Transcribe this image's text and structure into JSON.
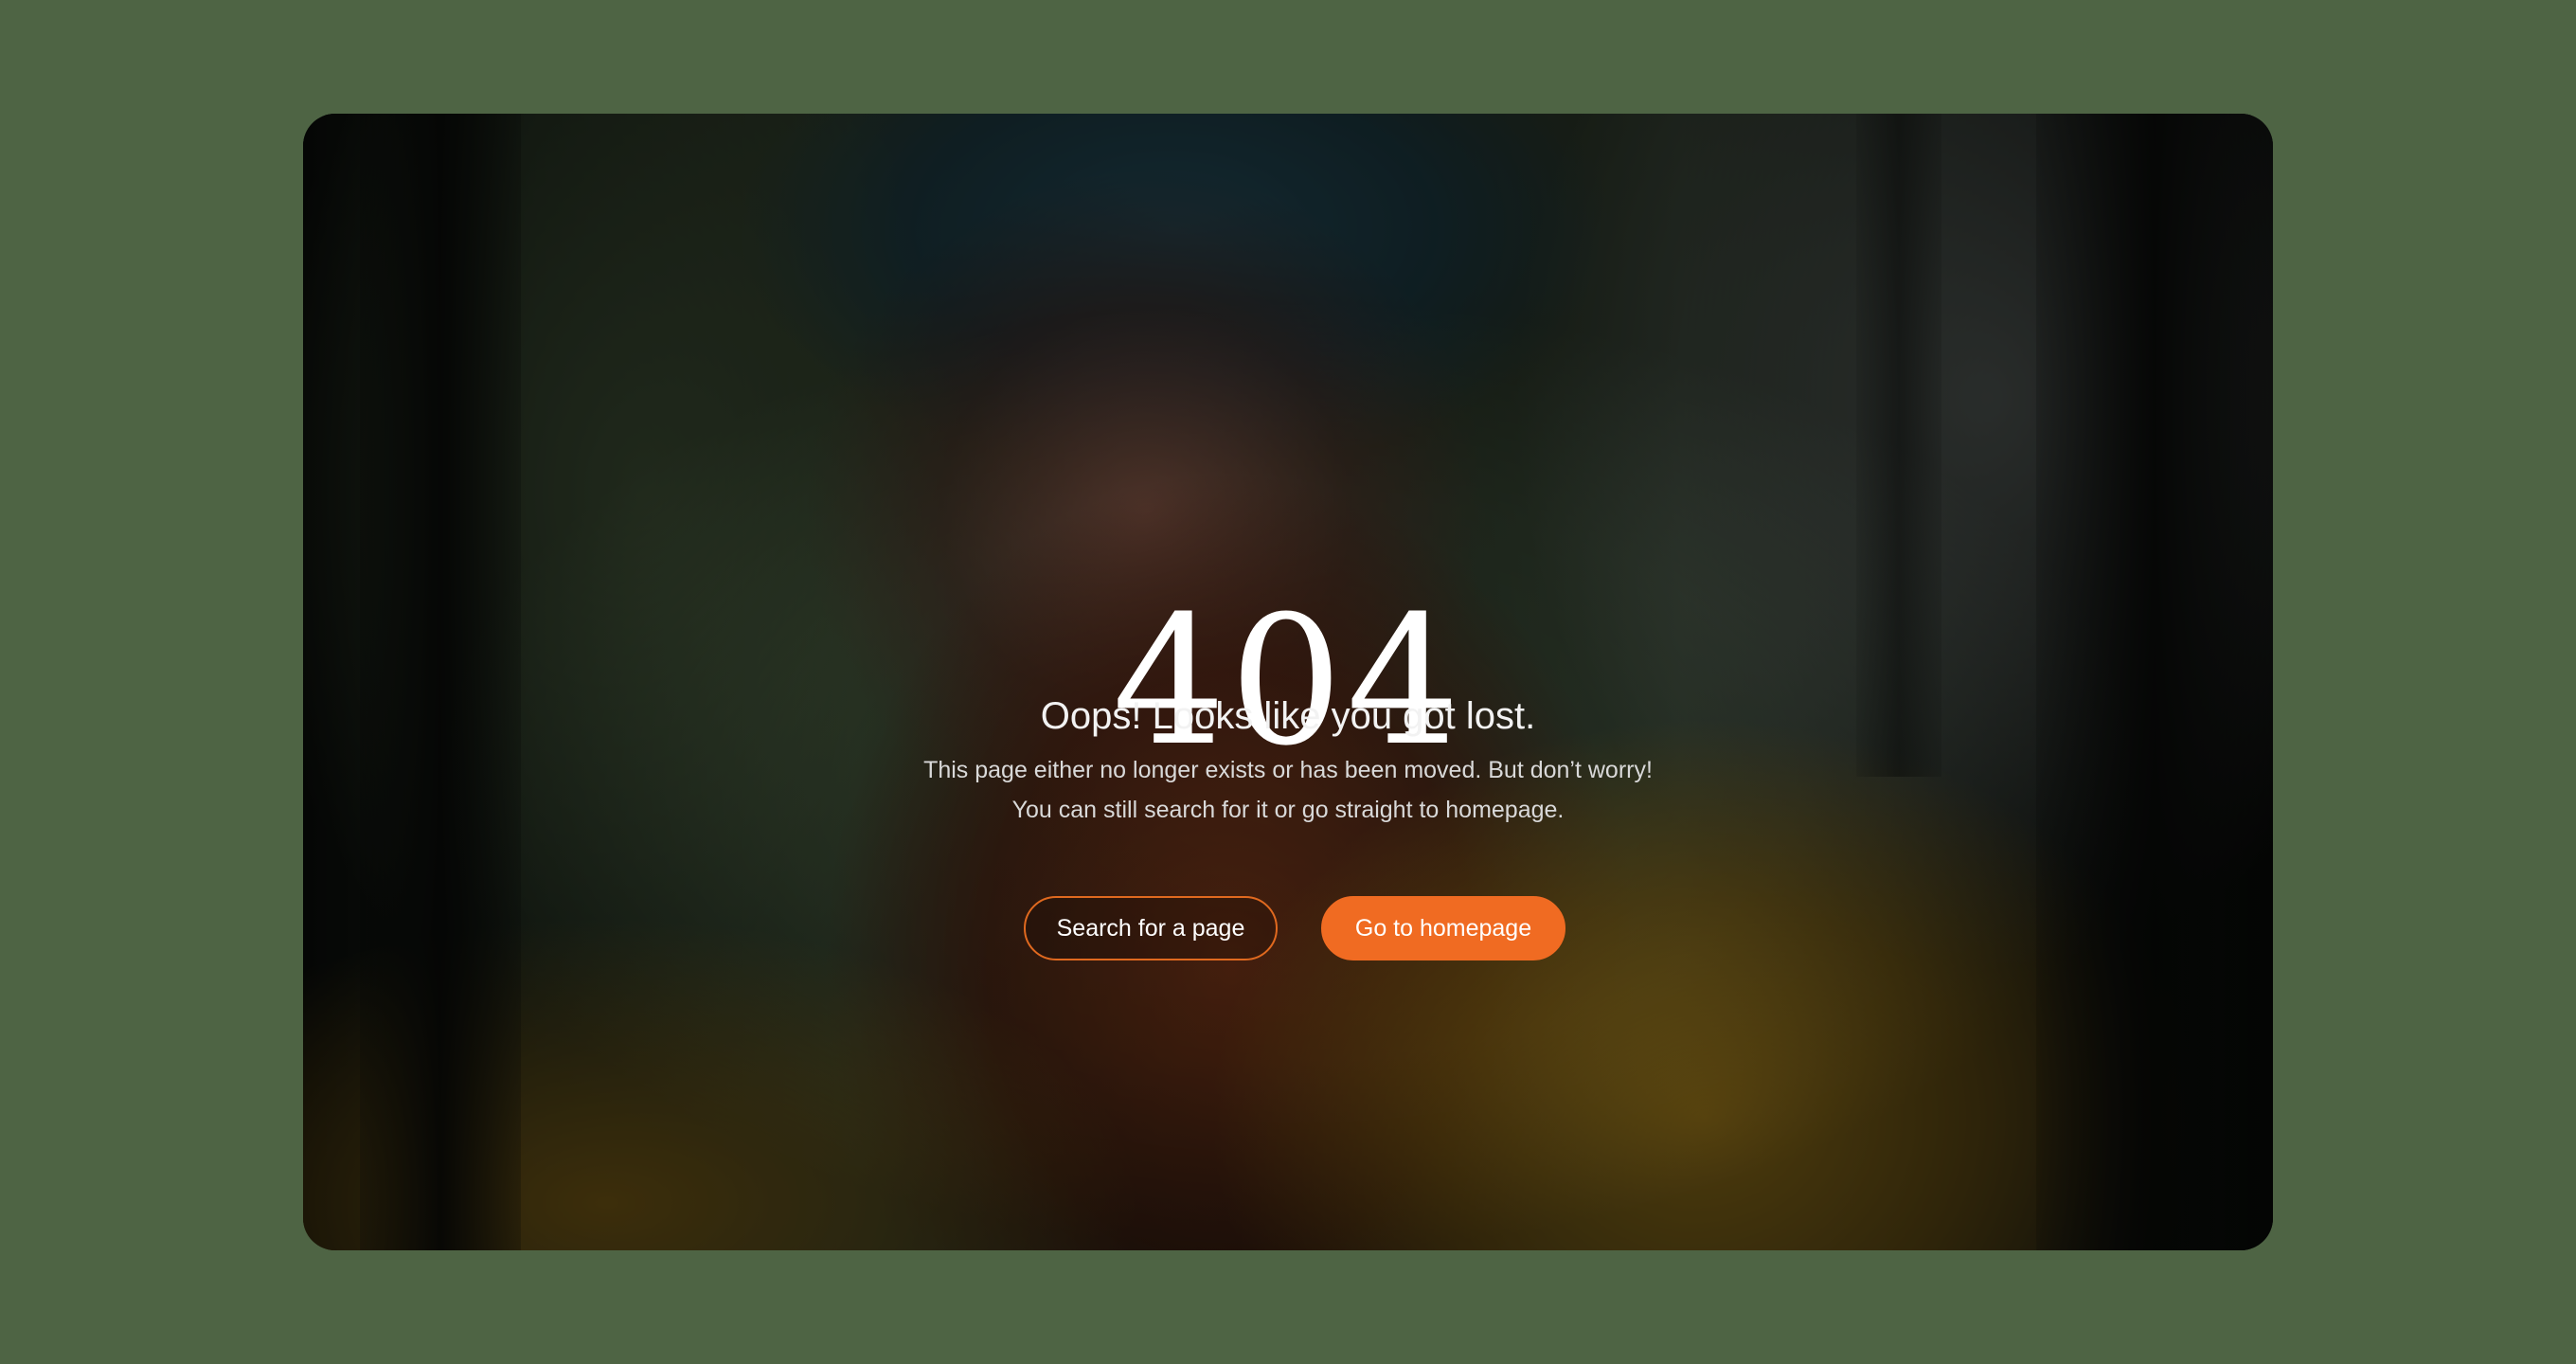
{
  "error": {
    "code": "404",
    "headline": "Oops! Looks like you got lost.",
    "message_line1": "This page either no longer exists or has been moved. But don’t worry!",
    "message_line2": "You can still search for it or go straight to homepage."
  },
  "actions": {
    "search_label": "Search for a page",
    "home_label": "Go to homepage"
  },
  "colors": {
    "page_background": "#4e6444",
    "accent": "#f06b22"
  }
}
